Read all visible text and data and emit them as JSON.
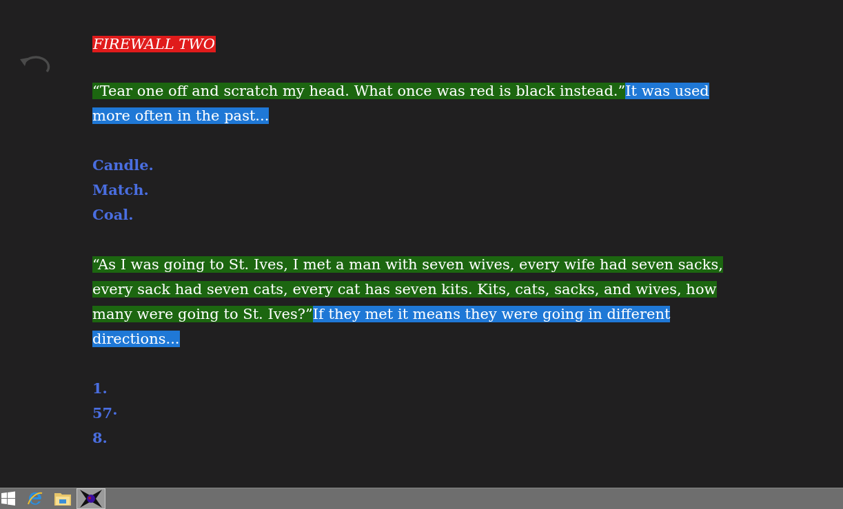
{
  "title": "FIREWALL TWO",
  "blocks": [
    {
      "kind": "riddle",
      "quote": "“Tear one off and scratch my head. What once was red is black instead.”",
      "answer": "It was used more often in the past..."
    },
    {
      "kind": "answers",
      "items": [
        "Candle.",
        "Match.",
        "Coal."
      ]
    },
    {
      "kind": "riddle",
      "quote": "“As I was going to St. Ives, I met a man with seven wives, every wife had seven sacks, every sack had seven cats, every cat has seven kits. Kits, cats, sacks, and wives, how many were going to St. Ives?”",
      "answer": "If they met it means they were going in different directions..."
    },
    {
      "kind": "answers",
      "items": [
        "1.",
        "57·",
        "8."
      ]
    }
  ]
}
